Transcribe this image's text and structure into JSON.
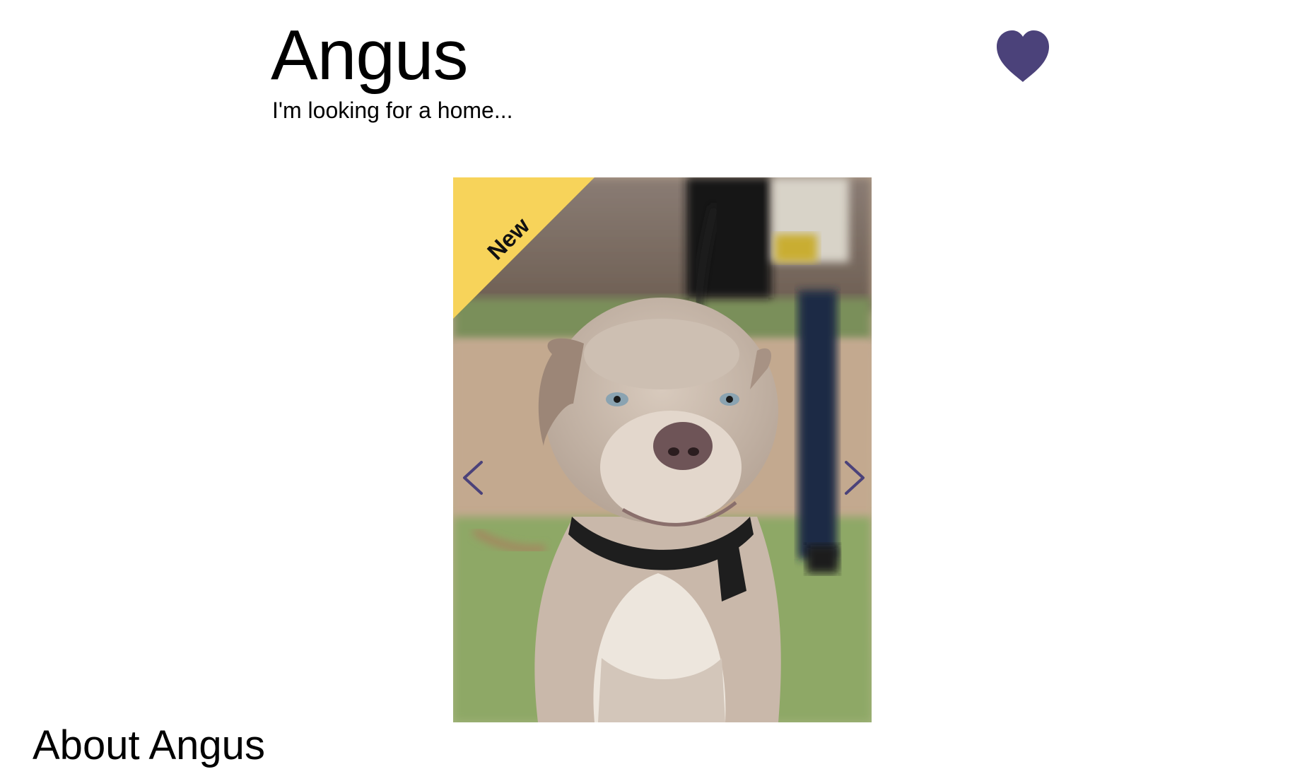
{
  "pet": {
    "name": "Angus",
    "tagline": "I'm looking for a home..."
  },
  "favorite": {
    "icon": "heart-icon",
    "color": "#4b427a"
  },
  "gallery": {
    "badge": "New",
    "badge_color": "#f7d35a",
    "arrow_color": "#4b427a",
    "prev_icon": "chevron-left-icon",
    "next_icon": "chevron-right-icon"
  },
  "about": {
    "title": "About Angus"
  }
}
